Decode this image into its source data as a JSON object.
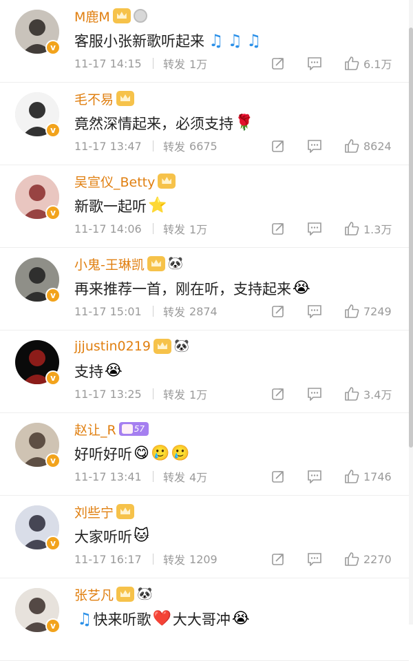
{
  "comments": [
    {
      "username": "M鹿M",
      "text": "客服小张新歌听起来",
      "emojis": [],
      "notes": [
        "♫",
        "♫",
        "♫"
      ],
      "time": "11-17 14:15",
      "repost_label": "转发",
      "reposts": "1万",
      "likes": "6.1万",
      "badges": [
        "crown",
        "medal"
      ]
    },
    {
      "username": "毛不易",
      "text": "竟然深情起来，必须支持",
      "emojis": [
        "🌹"
      ],
      "notes": [],
      "time": "11-17 13:47",
      "repost_label": "转发",
      "reposts": "6675",
      "likes": "8624",
      "badges": [
        "crown"
      ]
    },
    {
      "username": "吴宣仪_Betty",
      "text": "新歌一起听",
      "emojis": [
        "⭐"
      ],
      "notes": [],
      "time": "11-17 14:06",
      "repost_label": "转发",
      "reposts": "1万",
      "likes": "1.3万",
      "badges": [
        "crown"
      ]
    },
    {
      "username": "小鬼-王琳凯",
      "text": "再来推荐一首，刚在听，支持起来",
      "emojis": [
        "😭"
      ],
      "notes": [],
      "time": "11-17 15:01",
      "repost_label": "转发",
      "reposts": "2874",
      "likes": "7249",
      "badges": [
        "crown",
        "panda"
      ]
    },
    {
      "username": "jjjustin0219",
      "text": "支持",
      "emojis": [
        "😭"
      ],
      "notes": [],
      "time": "11-17 13:25",
      "repost_label": "转发",
      "reposts": "1万",
      "likes": "3.4万",
      "badges": [
        "crown",
        "panda"
      ]
    },
    {
      "username": "赵让_R",
      "text": "好听好听",
      "emojis": [
        "😋",
        "🥲",
        "🥲"
      ],
      "notes": [],
      "time": "11-17 13:41",
      "repost_label": "转发",
      "reposts": "4万",
      "likes": "1746",
      "badges": [
        "level"
      ],
      "level": "57"
    },
    {
      "username": "刘些宁",
      "text": "大家听听",
      "emojis": [
        "🐱"
      ],
      "notes": [],
      "time": "11-17 16:17",
      "repost_label": "转发",
      "reposts": "1209",
      "likes": "2270",
      "badges": [
        "crown"
      ]
    },
    {
      "username": "张艺凡",
      "text": "快来听歌",
      "text2": "大大哥冲",
      "emojis": [
        "❤️"
      ],
      "emojis2": [
        "😭"
      ],
      "lead": "♫",
      "notes": [],
      "time": "",
      "repost_label": "",
      "reposts": "",
      "likes": "",
      "badges": [
        "crown",
        "panda"
      ]
    }
  ],
  "verified_glyph": "v",
  "colors": {
    "username": "#e07f10",
    "meta": "#9a9a9a",
    "note": "#2b90e8",
    "badge": "#f2a31c"
  }
}
